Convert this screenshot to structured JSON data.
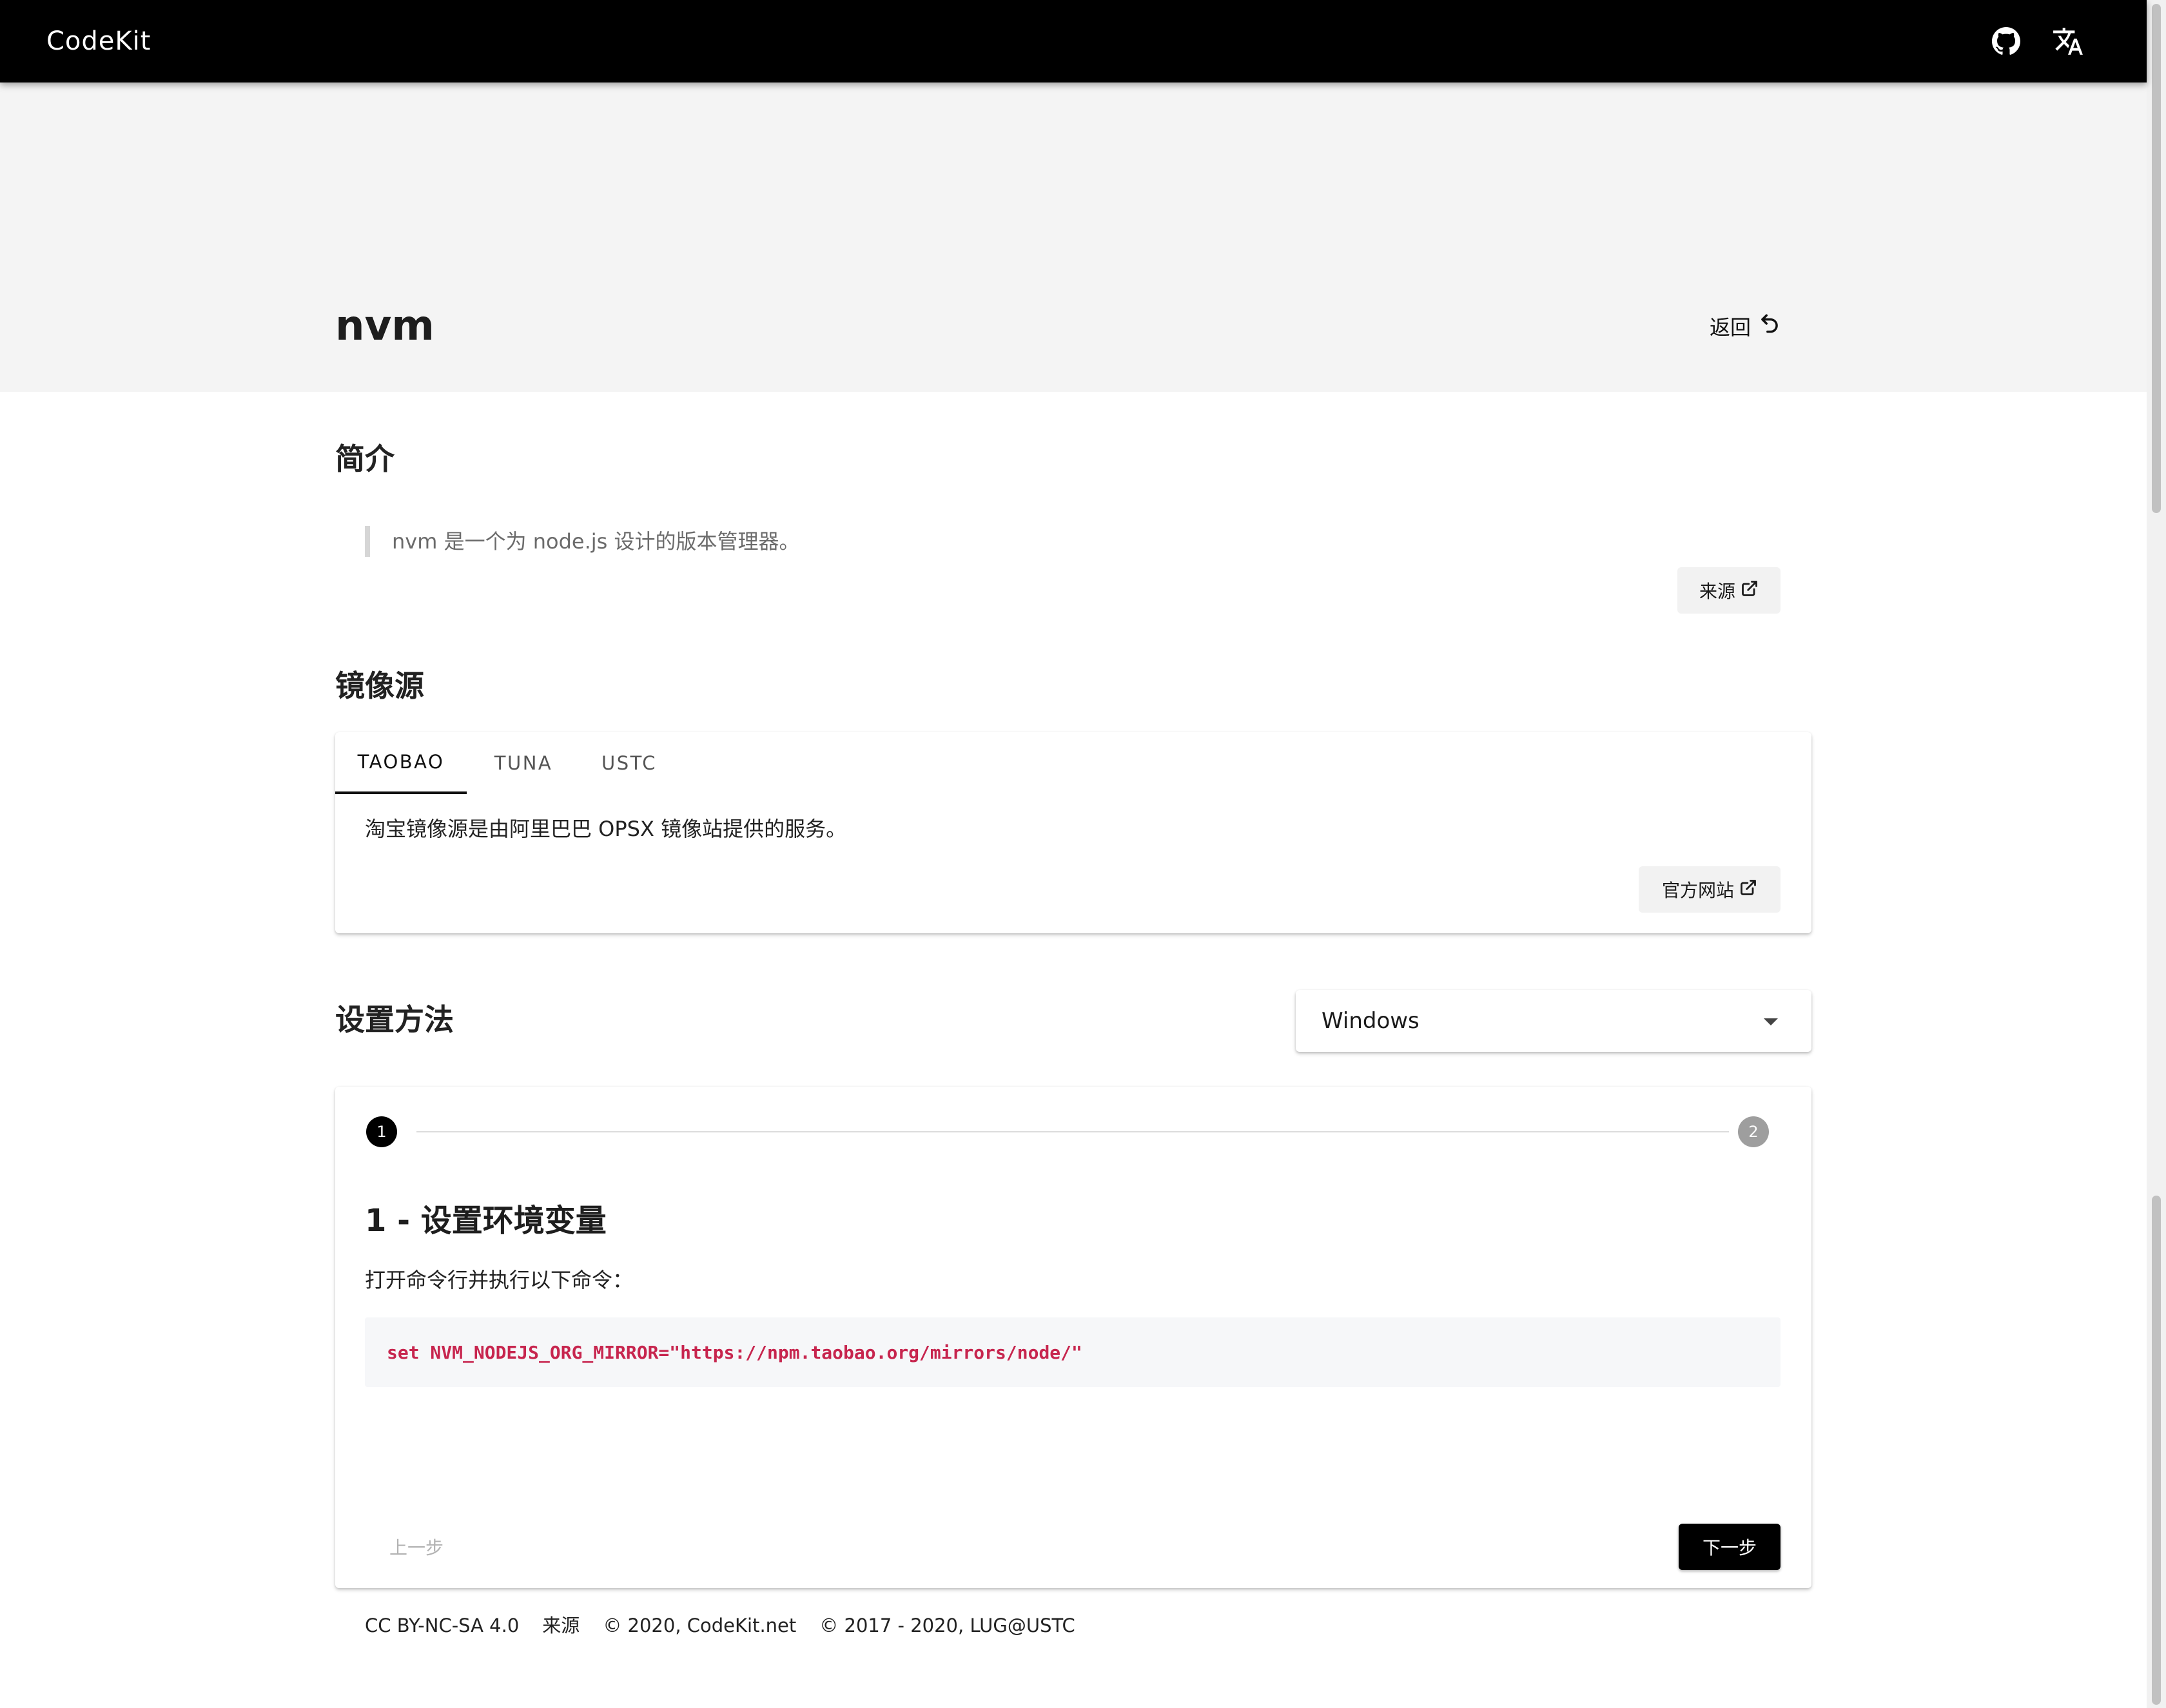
{
  "app_bar": {
    "title": "CodeKit",
    "github_icon": "github-icon",
    "translate_icon": "translate-icon"
  },
  "header": {
    "title": "nvm",
    "back_label": "返回",
    "back_icon": "undo-arrow-icon"
  },
  "intro": {
    "heading": "简介",
    "description": "nvm 是一个为 node.js 设计的版本管理器。",
    "source_button_label": "来源",
    "source_icon": "external-link-icon"
  },
  "mirrors": {
    "heading": "镜像源",
    "tabs": [
      {
        "label": "TAOBAO",
        "active": true
      },
      {
        "label": "TUNA",
        "active": false
      },
      {
        "label": "USTC",
        "active": false
      }
    ],
    "description": "淘宝镜像源是由阿里巴巴 OPSX 镜像站提供的服务。",
    "official_site_label": "官方网站",
    "official_site_icon": "external-link-icon"
  },
  "setup": {
    "heading": "设置方法",
    "os_select_value": "Windows",
    "steps": [
      {
        "number": "1",
        "state": "active"
      },
      {
        "number": "2",
        "state": "inactive"
      }
    ],
    "step_title": "1 - 设置环境变量",
    "step_instruction": "打开命令行并执行以下命令：",
    "command": "set NVM_NODEJS_ORG_MIRROR=\"https://npm.taobao.org/mirrors/node/\"",
    "prev_label": "上一步",
    "next_label": "下一步"
  },
  "footer": {
    "license": "CC BY-NC-SA 4.0",
    "source": "来源",
    "copyright_codekit": "© 2020, CodeKit.net",
    "copyright_lug": "© 2017 - 2020, LUG@USTC"
  },
  "colors": {
    "app_bar_bg": "#000000",
    "header_band_bg": "#f4f4f4",
    "code_text": "#c7254e",
    "code_bg": "#f6f7f9",
    "primary_button_bg": "#000000"
  }
}
